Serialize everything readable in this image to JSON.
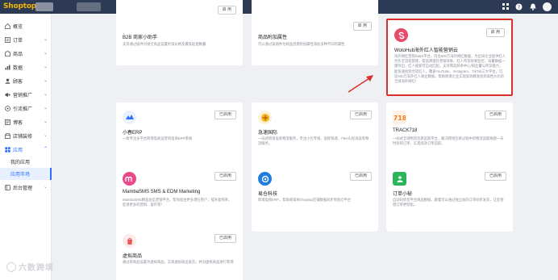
{
  "topbar": {
    "logo": "Shoptop",
    "icons": [
      "grid-icon",
      "help-icon",
      "bell-icon",
      "avatar"
    ]
  },
  "sidebar": {
    "items": [
      {
        "label": "概览",
        "icon": "home-icon",
        "chevron": false
      },
      {
        "label": "订单",
        "icon": "order-icon",
        "chevron": true
      },
      {
        "label": "商品",
        "icon": "product-icon",
        "chevron": true
      },
      {
        "label": "数据",
        "icon": "data-icon",
        "chevron": true
      },
      {
        "label": "顾客",
        "icon": "customer-icon",
        "chevron": true
      },
      {
        "label": "营销推广",
        "icon": "marketing-icon",
        "chevron": true
      },
      {
        "label": "引流推广",
        "icon": "traffic-icon",
        "chevron": true
      },
      {
        "label": "博客",
        "icon": "blog-icon",
        "chevron": true
      },
      {
        "label": "店铺装修",
        "icon": "store-icon",
        "chevron": true
      },
      {
        "label": "应用",
        "icon": "apps-icon",
        "chevron": true
      }
    ],
    "subitems": [
      {
        "label": "我的应用"
      },
      {
        "label": "应用市场"
      }
    ],
    "bottom": {
      "label": "后台管理",
      "icon": "admin-icon"
    },
    "watermark": "六数跨境"
  },
  "cards": [
    {
      "title": "B2B 商家小助手",
      "button": "启 用",
      "desc": "支持通过插件对接全商品设置折扣价格及最低起批数量",
      "icon": "b2b-icon",
      "color": "#2d7ff9"
    },
    {
      "title": "商品附加属性",
      "button": "启 用",
      "desc": "可以通过该插件为商品创建附加属性添加多种不同的属性",
      "icon": "attribute-icon",
      "color": "#1aa7e6"
    },
    {
      "title": "WotoHub海外红人智能营销云",
      "button": "启 用",
      "desc": "海外网红营销SaaS平台，内含500万海外网红数据，为出海企业提供红人合作全流程管理，帮品牌提升营销效果，红人带货效果监控，海量数据一键导出，红人搜索可自动匹配，支持筛选频率中心/粉丝量与带货能力，能快速找到合适红人，覆盖YouTube、Instagram、TikTok三大平台，沉淀600万海外红人商业数据，帮助跨境企业实现高效精准找到高性价比的全球海外网红!",
      "icon": "wotohub-icon",
      "color": "#e84a6a"
    },
    {
      "title": "小春ERP",
      "button": "已启用",
      "desc": "一款专注多平台跨境电商运营的电商ERP系统",
      "icon": "erp-icon",
      "color": "#2b6fff"
    },
    {
      "title": "急速国际",
      "button": "已启用",
      "desc": "一站式跨境电商物流服务，专注小包专线、国际快递、FBA头程海运等物流服务。",
      "icon": "express-icon",
      "color": "#f3b522"
    },
    {
      "title": "TRACK718",
      "button": "已启用",
      "desc": "一站式全球物流包裹追踪平台，解决跨境包裹过程中的物流追踪难题一天时效的订单，实现高效订单追踪。",
      "icon": "track-icon",
      "color": "#ff7a1a"
    },
    {
      "title": "MambaSMS SMS & EDM Marketing",
      "button": "已启用",
      "desc": "MambaSMS精准短信营销平台，帮你留住更多潜在用户，提升复购率，促进更多的营销、留存等！",
      "icon": "mamba-icon",
      "color": "#e84a8a"
    },
    {
      "title": "易仓科技",
      "button": "已启用",
      "desc": "跨境电商ERP，帮助商家将Shoptop店铺数据同步到易仓平台",
      "icon": "ecang-icon",
      "color": "#1f7ce0"
    },
    {
      "title": "订单小秘",
      "button": "已启用",
      "desc": "自动同步您平台商品数据，跟着可以通过独立站的订单同步发货，让您管理订单更轻松。",
      "icon": "order-secretary-icon",
      "color": "#2cb55a"
    },
    {
      "title": "虚拟商品",
      "button": "已启用",
      "desc": "通过将商品设置为虚拟商品，实现虚拟商品发货，并对虚拟商品进行管理",
      "icon": "virtual-goods-icon",
      "color": "#e85a5a"
    }
  ]
}
